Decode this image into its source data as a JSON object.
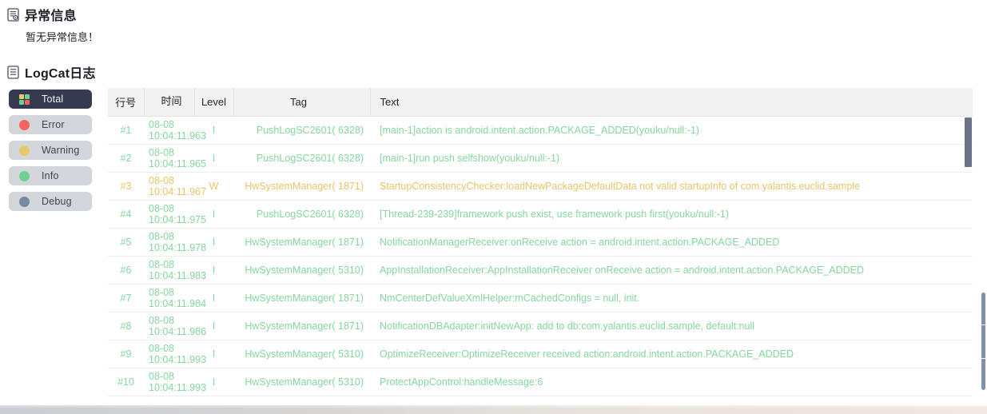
{
  "sections": {
    "abnormal": {
      "icon": "document-gear-icon",
      "title": "异常信息",
      "empty_note": "暂无异常信息！"
    },
    "logcat": {
      "icon": "document-list-icon",
      "title": "LogCat日志"
    }
  },
  "level_filters": [
    {
      "key": "total",
      "label": "Total",
      "icon": "four-squares-icon",
      "active": true,
      "colors": [
        "#e8c96a",
        "#6fcf93",
        "#6fcf93",
        "#f4645f"
      ]
    },
    {
      "key": "error",
      "label": "Error",
      "icon": "dot-icon",
      "active": false,
      "color": "#f4645f"
    },
    {
      "key": "warning",
      "label": "Warning",
      "icon": "dot-icon",
      "active": false,
      "color": "#e8c96a"
    },
    {
      "key": "info",
      "label": "Info",
      "icon": "dot-icon",
      "active": false,
      "color": "#6fcf93"
    },
    {
      "key": "debug",
      "label": "Debug",
      "icon": "dot-icon",
      "active": false,
      "color": "#7a89a3"
    }
  ],
  "table": {
    "columns": [
      "行号",
      "时间",
      "Level",
      "Tag",
      "Text"
    ],
    "rows": [
      {
        "no": "#1",
        "date": "08-08",
        "time": "10:04:11.963",
        "level": "I",
        "tag": "PushLogSC2601( 6328)",
        "text": "[main-1]action is android.intent.action.PACKAGE_ADDED(youku/null:-1)"
      },
      {
        "no": "#2",
        "date": "08-08",
        "time": "10:04:11.965",
        "level": "I",
        "tag": "PushLogSC2601( 6328)",
        "text": "[main-1]run push selfshow(youku/null:-1)"
      },
      {
        "no": "#3",
        "date": "08-08",
        "time": "10:04:11.967",
        "level": "W",
        "tag": "HwSystemManager( 1871)",
        "text": "StartupConsistencyChecker:loadNewPackageDefaultData not valid startupInfo of com.yalantis.euclid.sample"
      },
      {
        "no": "#4",
        "date": "08-08",
        "time": "10:04:11.975",
        "level": "I",
        "tag": "PushLogSC2601( 6328)",
        "text": "[Thread-239-239]framework push exist, use framework push first(youku/null:-1)"
      },
      {
        "no": "#5",
        "date": "08-08",
        "time": "10:04:11.978",
        "level": "I",
        "tag": "HwSystemManager( 1871)",
        "text": "NotificationManagerReceiver:onReceive action = android.intent.action.PACKAGE_ADDED"
      },
      {
        "no": "#6",
        "date": "08-08",
        "time": "10:04:11.983",
        "level": "I",
        "tag": "HwSystemManager( 5310)",
        "text": "AppInstallationReceiver:AppInstallationReceiver onReceive action = android.intent.action.PACKAGE_ADDED"
      },
      {
        "no": "#7",
        "date": "08-08",
        "time": "10:04:11.984",
        "level": "I",
        "tag": "HwSystemManager( 1871)",
        "text": "NmCenterDefValueXmlHelper:mCachedConfigs = null, init."
      },
      {
        "no": "#8",
        "date": "08-08",
        "time": "10:04:11.986",
        "level": "I",
        "tag": "HwSystemManager( 1871)",
        "text": "NotificationDBAdapter:initNewApp: add to db:com.yalantis.euclid.sample, default:null"
      },
      {
        "no": "#9",
        "date": "08-08",
        "time": "10:04:11.993",
        "level": "I",
        "tag": "HwSystemManager( 5310)",
        "text": "OptimizeReceiver:OptimizeReceiver received action:android.intent.action.PACKAGE_ADDED"
      },
      {
        "no": "#10",
        "date": "08-08",
        "time": "10:04:11.993",
        "level": "I",
        "tag": "HwSystemManager( 5310)",
        "text": "ProtectAppControl:handleMessage:6"
      }
    ]
  },
  "colors": {
    "info": "#85d6a0",
    "warning": "#e8c46a",
    "error": "#f4645f",
    "debug": "#7a89a3",
    "active_filter_bg": "#343a50",
    "filter_bg": "#d3d7dc",
    "header_bg": "#f2f2f2"
  }
}
